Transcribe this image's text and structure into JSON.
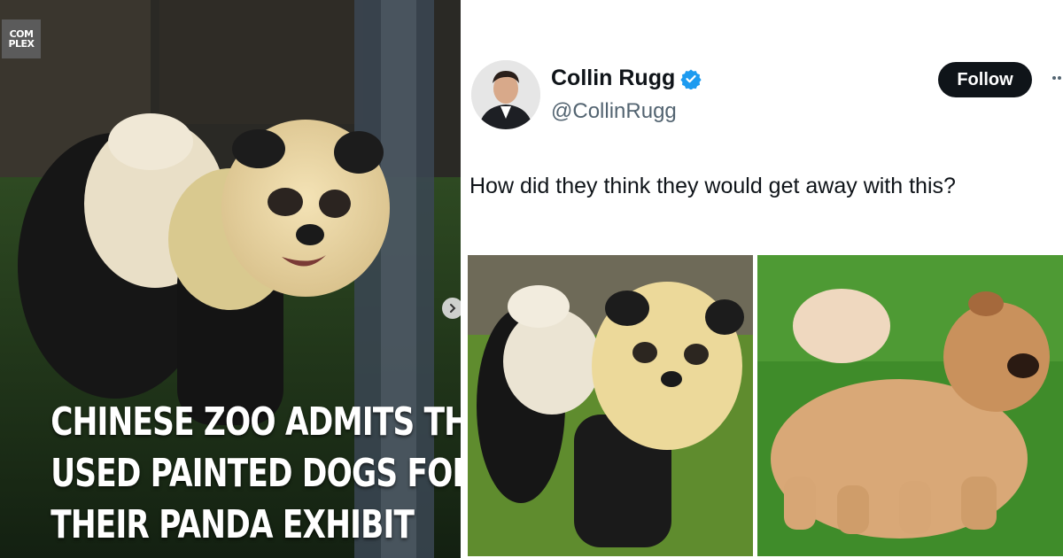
{
  "thumbnail": {
    "brand_logo": [
      "COM",
      "PLEX"
    ],
    "headline_lines": [
      "CHINESE ZOO ADMITS THEY",
      "USED PAINTED DOGS FOR",
      "THEIR PANDA EXHIBIT"
    ],
    "next_icon": "chevron-right-icon"
  },
  "tweet": {
    "display_name": "Collin Rugg",
    "handle": "@CollinRugg",
    "verified_icon": "verified-badge-icon",
    "follow_label": "Follow",
    "more_icon": "more-horizontal-icon",
    "text": "How did they think they would get away with this?",
    "colors": {
      "verified": "#1d9bf0",
      "follow_bg": "#0f1419",
      "name": "#0f1419",
      "handle": "#536471"
    }
  }
}
